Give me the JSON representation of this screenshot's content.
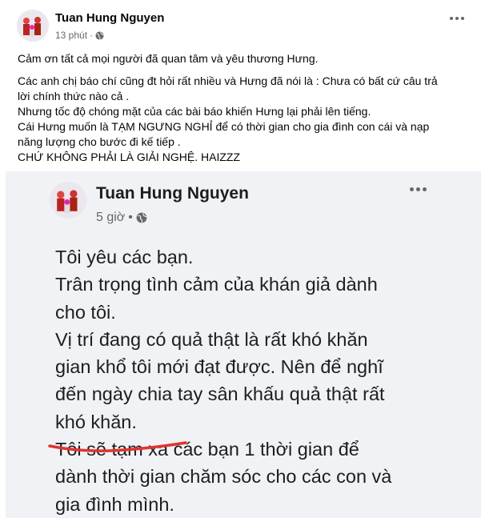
{
  "post": {
    "author": "Tuan Hung Nguyen",
    "time": "13 phút",
    "separator": "·",
    "privacy_icon": "globe-icon",
    "more_icon": "more-options-icon",
    "lines": [
      "Cảm ơn tất cả mọi người đã quan tâm và yêu thương Hưng.",
      "Các anh chị báo chí cũng đt hỏi rất nhiều và Hưng đã nói là : Chưa có bất cứ câu trả",
      "lời chính thức nào cả .",
      "Nhưng tốc độ chóng mặt của các bài báo khiến Hưng lại phải lên tiếng.",
      "Cái Hưng muốn là TẠM NGƯNG NGHỈ để có thời gian cho gia đình con cái và nạp",
      "năng lượng cho bước đi kế tiếp .",
      "CHỨ KHÔNG PHẢI LÀ GIẢI NGHỆ. HAIZZZ"
    ]
  },
  "embedded": {
    "author": "Tuan Hung Nguyen",
    "time": "5 giờ",
    "separator": "•",
    "privacy_icon": "globe-icon",
    "more_icon": "more-options-icon",
    "lines": [
      "Tôi yêu các bạn.",
      "Trân trọng tình cảm của khán giả dành",
      "cho tôi.",
      "Vị trí đang có quả thật là rất khó khăn",
      "gian khổ tôi mới đạt được. Nên để nghĩ",
      "đến ngày chia tay sân khấu quả thật rất",
      "khó khăn.",
      "Tôi  sẽ tạm xa các bạn 1 thời gian để",
      "dành thời gian chăm sóc cho các con và",
      "gia đình mình."
    ],
    "underline_color": "#e0342f"
  }
}
